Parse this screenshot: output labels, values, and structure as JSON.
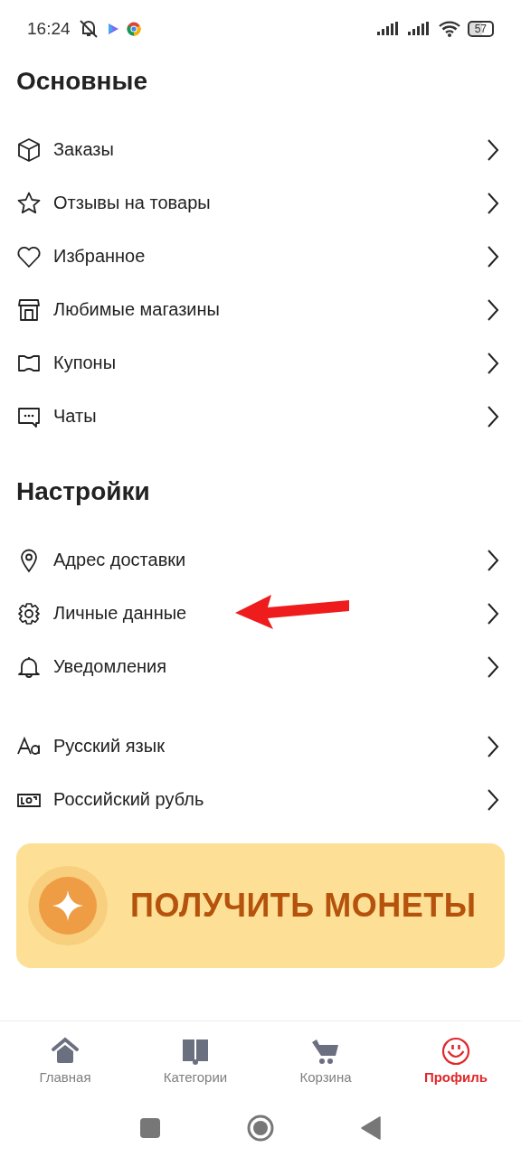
{
  "status_bar": {
    "time": "16:24",
    "battery": "57"
  },
  "sections": [
    {
      "title": "Основные",
      "groups": [
        [
          {
            "label": "Заказы"
          },
          {
            "label": "Отзывы на товары"
          },
          {
            "label": "Избранное"
          },
          {
            "label": "Любимые магазины"
          },
          {
            "label": "Купоны"
          },
          {
            "label": "Чаты"
          }
        ]
      ]
    },
    {
      "title": "Настройки",
      "groups": [
        [
          {
            "label": "Адрес доставки"
          },
          {
            "label": "Личные данные"
          },
          {
            "label": "Уведомления"
          }
        ],
        [
          {
            "label": "Русский язык"
          },
          {
            "label": "Российский рубль"
          }
        ]
      ]
    }
  ],
  "banner": {
    "text": "ПОЛУЧИТЬ МОНЕТЫ"
  },
  "bottom_nav": [
    {
      "label": "Главная",
      "selected": false
    },
    {
      "label": "Категории",
      "selected": false
    },
    {
      "label": "Корзина",
      "selected": false
    },
    {
      "label": "Профиль",
      "selected": true
    }
  ]
}
